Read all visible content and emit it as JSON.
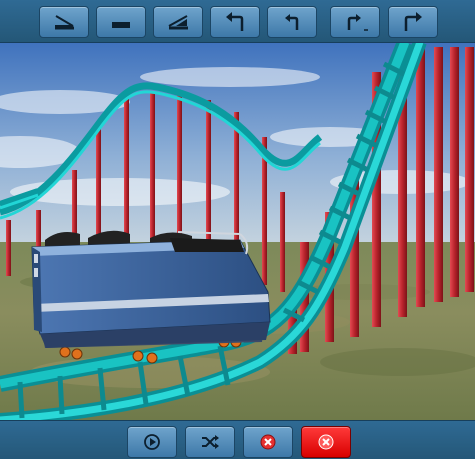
{
  "app": {
    "title": ""
  },
  "toolbar": {
    "buttons": [
      {
        "name": "slope-down-button",
        "icon": "slope-down-icon"
      },
      {
        "name": "straight-button",
        "icon": "straight-track-icon"
      },
      {
        "name": "slope-up-button",
        "icon": "slope-up-icon"
      },
      {
        "name": "turn-left-sharp-button",
        "icon": "turn-left-sharp-icon"
      },
      {
        "name": "turn-left-button",
        "icon": "turn-left-icon"
      },
      {
        "name": "turn-right-button",
        "icon": "turn-right-icon"
      },
      {
        "name": "turn-right-sharp-button",
        "icon": "turn-right-sharp-icon"
      }
    ]
  },
  "bottombar": {
    "buttons": [
      {
        "name": "play-button",
        "icon": "play-icon"
      },
      {
        "name": "shuffle-button",
        "icon": "shuffle-icon"
      },
      {
        "name": "delete-button",
        "icon": "close-icon"
      },
      {
        "name": "clear-all-button",
        "icon": "close-icon",
        "state": "active"
      }
    ]
  },
  "colors": {
    "track": "#19c3c3",
    "support": "#b3212b",
    "car": "#3f6aa2",
    "toolbar": "#2b6389",
    "active_button": "#ff1010"
  }
}
